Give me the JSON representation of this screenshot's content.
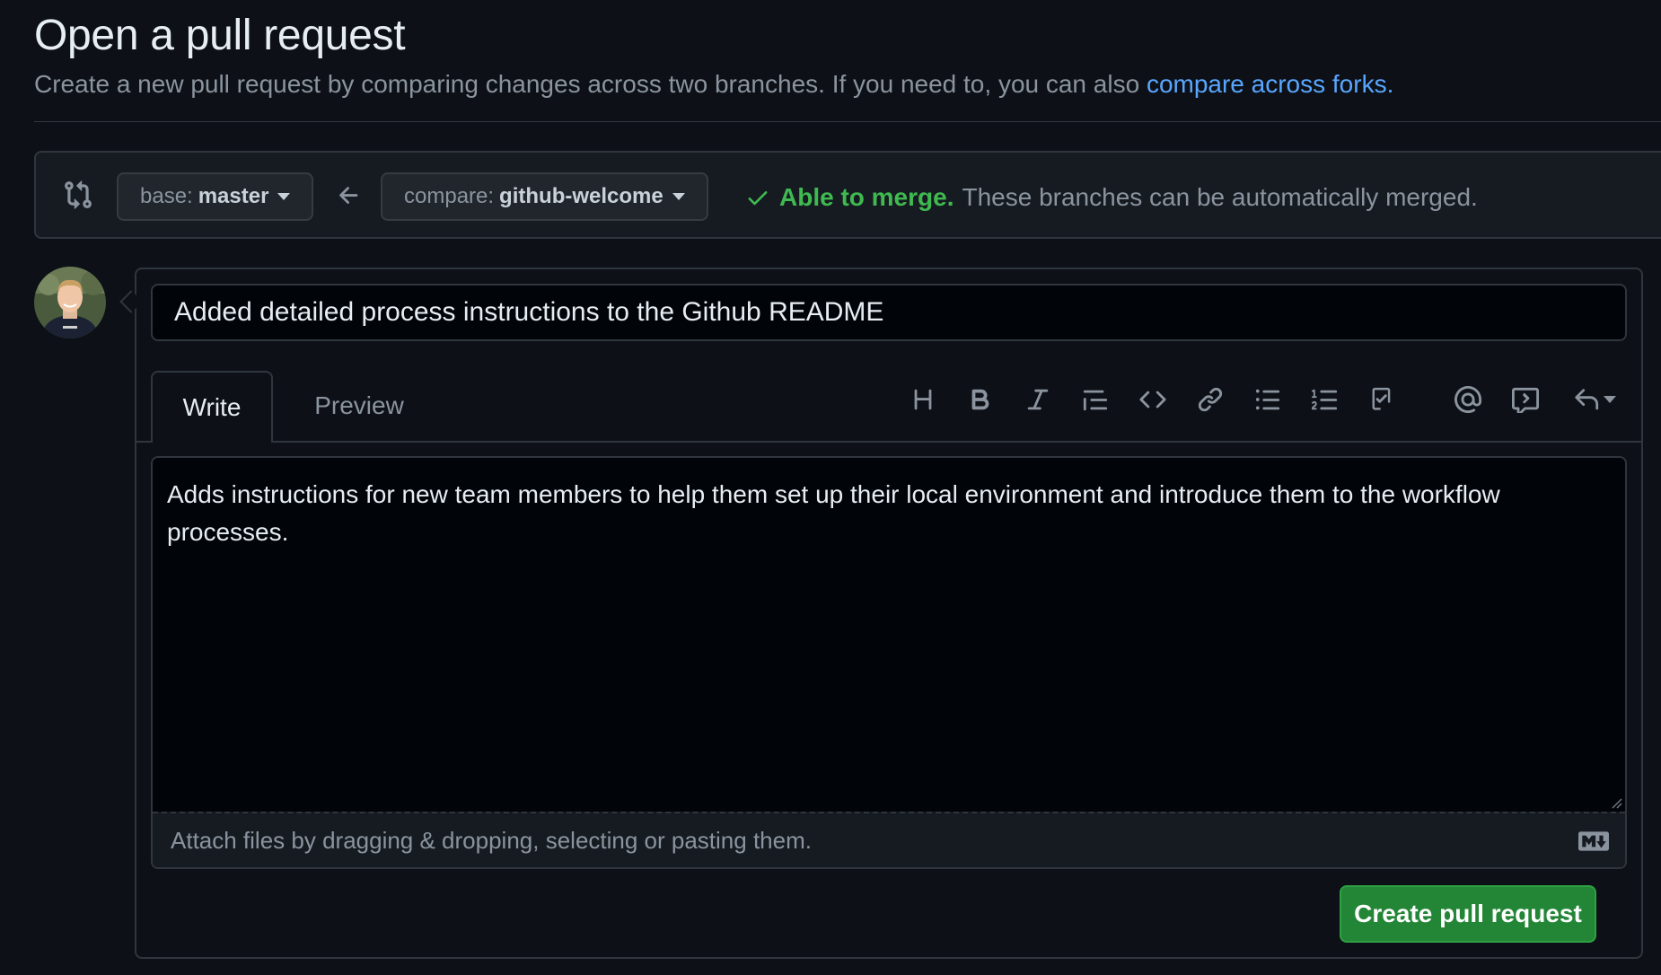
{
  "page": {
    "title": "Open a pull request",
    "subtitle": "Create a new pull request by comparing changes across two branches. If you need to, you can also",
    "subtitle_link": "compare across forks."
  },
  "compare": {
    "base_prefix": "base:",
    "base_branch": "master",
    "compare_prefix": "compare:",
    "compare_branch": "github-welcome",
    "merge_ok": "Able to merge.",
    "merge_detail": "These branches can be automatically merged."
  },
  "form": {
    "title_value": "Added detailed process instructions to the Github README",
    "tabs": [
      {
        "label": "Write",
        "active": true
      },
      {
        "label": "Preview",
        "active": false
      }
    ],
    "toolbar": [
      "heading-icon",
      "bold-icon",
      "italic-icon",
      "quote-icon",
      "code-icon",
      "link-icon",
      "bulleted-list-icon",
      "numbered-list-icon",
      "task-list-icon",
      "mention-icon",
      "reference-icon",
      "saved-replies-icon"
    ],
    "body_value": "Adds instructions for new team members to help them set up their local environment and introduce them to the workflow processes.",
    "attach_text": "Attach files by dragging & dropping, selecting or pasting them.",
    "submit_label": "Create pull request"
  },
  "colors": {
    "background": "#0d1117",
    "link": "#58a6ff",
    "success": "#3fb950",
    "button": "#238636"
  }
}
